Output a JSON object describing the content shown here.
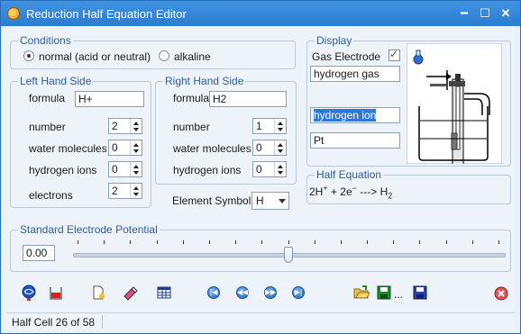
{
  "window": {
    "title": "Reduction Half Equation Editor"
  },
  "conditions": {
    "legend": "Conditions",
    "normal_label": "normal (acid or neutral)",
    "alkaline_label": "alkaline",
    "selected": "normal"
  },
  "left_side": {
    "legend": "Left Hand Side",
    "formula_label": "formula",
    "formula_value": "H+",
    "number_label": "number",
    "number_value": "2",
    "water_label": "water molecules",
    "water_value": "0",
    "hydrogen_ions_label": "hydrogen ions",
    "hydrogen_ions_value": "0",
    "electrons_label": "electrons",
    "electrons_value": "2"
  },
  "right_side": {
    "legend": "Right Hand Side",
    "formula_label": "formula",
    "formula_value": "H2",
    "number_label": "number",
    "number_value": "1",
    "water_label": "water molecules",
    "water_value": "0",
    "hydrogen_ions_label": "hydrogen ions",
    "hydrogen_ions_value": "0"
  },
  "element_symbol": {
    "label": "Element Symbol",
    "value": "H"
  },
  "display": {
    "legend": "Display",
    "gas_electrode_label": "Gas Electrode",
    "gas_electrode_checked": true,
    "gas_name": "hydrogen gas",
    "ion_name": "hydrogen ion",
    "electrode_name": "Pt"
  },
  "half_equation": {
    "legend": "Half Equation",
    "coef1": "2H",
    "sup1": "+",
    "mid": " + 2e",
    "sup2": "−",
    "arrow": " ---> H",
    "sub": "2"
  },
  "potential": {
    "legend": "Standard Electrode Potential",
    "value": "0.00",
    "slider_fraction": 0.5
  },
  "toolbar": {
    "ellipsis": "..."
  },
  "status": {
    "half_cell": "Half Cell 26 of 58"
  },
  "colors": {
    "title_bar": "#2e7cd0",
    "legend_text": "#2d5d9b",
    "selection": "#3077d6"
  }
}
